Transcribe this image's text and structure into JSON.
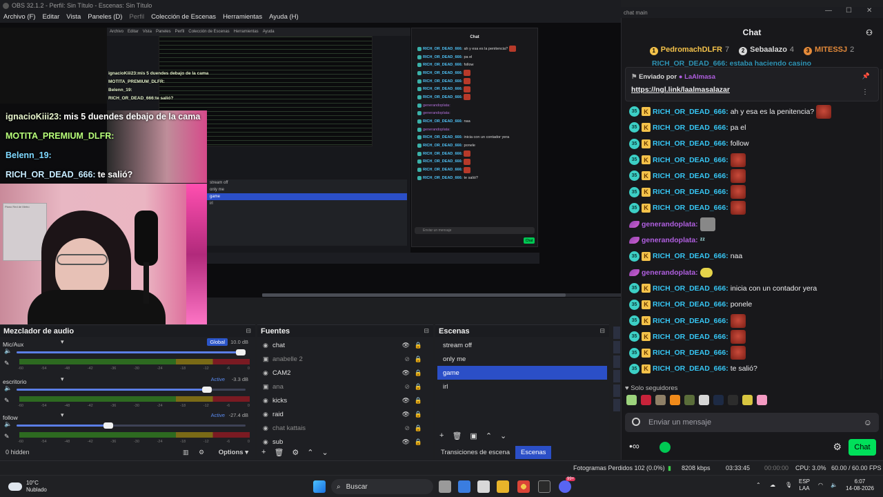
{
  "window": {
    "title": "OBS 32.1.2 - Perfil: Sin Título - Escenas: Sin Título"
  },
  "menu": [
    {
      "label": "Archivo (F)",
      "dim": false
    },
    {
      "label": "Editar",
      "dim": false
    },
    {
      "label": "Vista",
      "dim": false
    },
    {
      "label": "Paneles (D)",
      "dim": false
    },
    {
      "label": "Perfil",
      "dim": true
    },
    {
      "label": "Colección de Escenas",
      "dim": false
    },
    {
      "label": "Herramientas",
      "dim": false
    },
    {
      "label": "Ayuda (H)",
      "dim": false
    }
  ],
  "overlay_chat": {
    "lines": [
      {
        "user": "ignacioKiii23:",
        "text": "mis 5 duendes debajo de la cama"
      },
      {
        "user": "MOTITA_PREMIUM_DLFR:",
        "text": ""
      },
      {
        "user": "Belenn_19:",
        "text": ""
      },
      {
        "user": "RICH_OR_DEAD_666:",
        "text": "te salió?"
      }
    ]
  },
  "mixer": {
    "title": "Mezclador de audio",
    "ticks": [
      "-60",
      "-54",
      "-48",
      "-42",
      "-36",
      "-30",
      "-24",
      "-18",
      "-12",
      "-6",
      "0"
    ],
    "channels": [
      {
        "name": "Mic/Aux",
        "badge": "Global",
        "db": "10.0 dB",
        "level": 0.98
      },
      {
        "name": "escritorio",
        "badge": "Active",
        "db": "-3.3 dB",
        "level": 0.83
      },
      {
        "name": "follow",
        "badge": "Active",
        "db": "-27.4 dB",
        "level": 0.4
      }
    ],
    "hidden": "0 hidden",
    "options": "Options"
  },
  "sources": {
    "title": "Fuentes",
    "items": [
      {
        "name": "chat",
        "visible": true
      },
      {
        "name": "anabelle 2",
        "visible": false
      },
      {
        "name": "CAM2",
        "visible": true
      },
      {
        "name": "ana",
        "visible": false
      },
      {
        "name": "kicks",
        "visible": true
      },
      {
        "name": "raid",
        "visible": true
      },
      {
        "name": "chat kattais",
        "visible": false
      },
      {
        "name": "sub",
        "visible": true
      }
    ]
  },
  "scenes": {
    "title": "Escenas",
    "items": [
      "stream off",
      "only me",
      "game",
      "irl"
    ],
    "selected": 2,
    "tabs": [
      "Transiciones de escena",
      "Escenas"
    ]
  },
  "status": {
    "dropped": "Fotogramas Perdidos 102 (0.0%)",
    "kbps": "8208 kbps",
    "stream_time": "03:33:45",
    "rec_time": "00:00:00",
    "cpu": "CPU: 3.0%",
    "fps": "60.00 / 60.00 FPS"
  },
  "taskbar": {
    "weather_temp": "10°C",
    "weather_desc": "Nublado",
    "search": "Buscar",
    "lang1": "ESP",
    "lang2": "LAA",
    "time": "6:07",
    "date": "14-08-2026",
    "badge": "99+"
  },
  "chat": {
    "window_title": "chat main",
    "title": "Chat",
    "leaders": [
      {
        "rank": "1",
        "name": "PedromachDLFR",
        "count": "7",
        "color": "#f4c24a"
      },
      {
        "rank": "2",
        "name": "Sebaalazo",
        "count": "4",
        "color": "#d9d9d9"
      },
      {
        "rank": "3",
        "name": "MITESSJ",
        "count": "2",
        "color": "#e48a3a"
      }
    ],
    "peek": "RICH_OR_DEAD_666: estaba haciendo casino",
    "pinned": {
      "label": "Enviado por",
      "by": "LaAlmasa",
      "link": "https://ngl.link/laalmasalazar"
    },
    "messages": [
      {
        "user": "RICH_OR_DEAD_666:",
        "text": "ah y esa es la penitencia?",
        "kind": "sub",
        "emote": "red"
      },
      {
        "user": "RICH_OR_DEAD_666:",
        "text": "pa el",
        "kind": "sub",
        "emote": ""
      },
      {
        "user": "RICH_OR_DEAD_666:",
        "text": "follow",
        "kind": "sub",
        "emote": ""
      },
      {
        "user": "RICH_OR_DEAD_666:",
        "text": "",
        "kind": "sub",
        "emote": "red"
      },
      {
        "user": "RICH_OR_DEAD_666:",
        "text": "",
        "kind": "sub",
        "emote": "red"
      },
      {
        "user": "RICH_OR_DEAD_666:",
        "text": "",
        "kind": "sub",
        "emote": "red"
      },
      {
        "user": "RICH_OR_DEAD_666:",
        "text": "",
        "kind": "sub",
        "emote": "red"
      },
      {
        "user": "generandoplata:",
        "text": "",
        "kind": "feather",
        "emote": "gray"
      },
      {
        "user": "generandoplata:",
        "text": "",
        "kind": "feather",
        "emote": "zz"
      },
      {
        "user": "RICH_OR_DEAD_666:",
        "text": "naa",
        "kind": "sub",
        "emote": ""
      },
      {
        "user": "generandoplata:",
        "text": "",
        "kind": "feather",
        "emote": "yellow"
      },
      {
        "user": "RICH_OR_DEAD_666:",
        "text": "inicia con un contador yera",
        "kind": "sub",
        "emote": ""
      },
      {
        "user": "RICH_OR_DEAD_666:",
        "text": "ponele",
        "kind": "sub",
        "emote": ""
      },
      {
        "user": "RICH_OR_DEAD_666:",
        "text": "",
        "kind": "sub",
        "emote": "red"
      },
      {
        "user": "RICH_OR_DEAD_666:",
        "text": "",
        "kind": "sub",
        "emote": "red"
      },
      {
        "user": "RICH_OR_DEAD_666:",
        "text": "",
        "kind": "sub",
        "emote": "red"
      },
      {
        "user": "RICH_OR_DEAD_666:",
        "text": "te salió?",
        "kind": "sub",
        "emote": ""
      }
    ],
    "sub_badge": "35",
    "followers_only": "Solo seguidores",
    "input_placeholder": "Enviar un mensaje",
    "send": "Chat"
  },
  "colors": {
    "accent": "#2b4fc7",
    "twitch_cyan": "#36c6f4",
    "kick_green": "#00e05a",
    "purple": "#b05fe0"
  }
}
